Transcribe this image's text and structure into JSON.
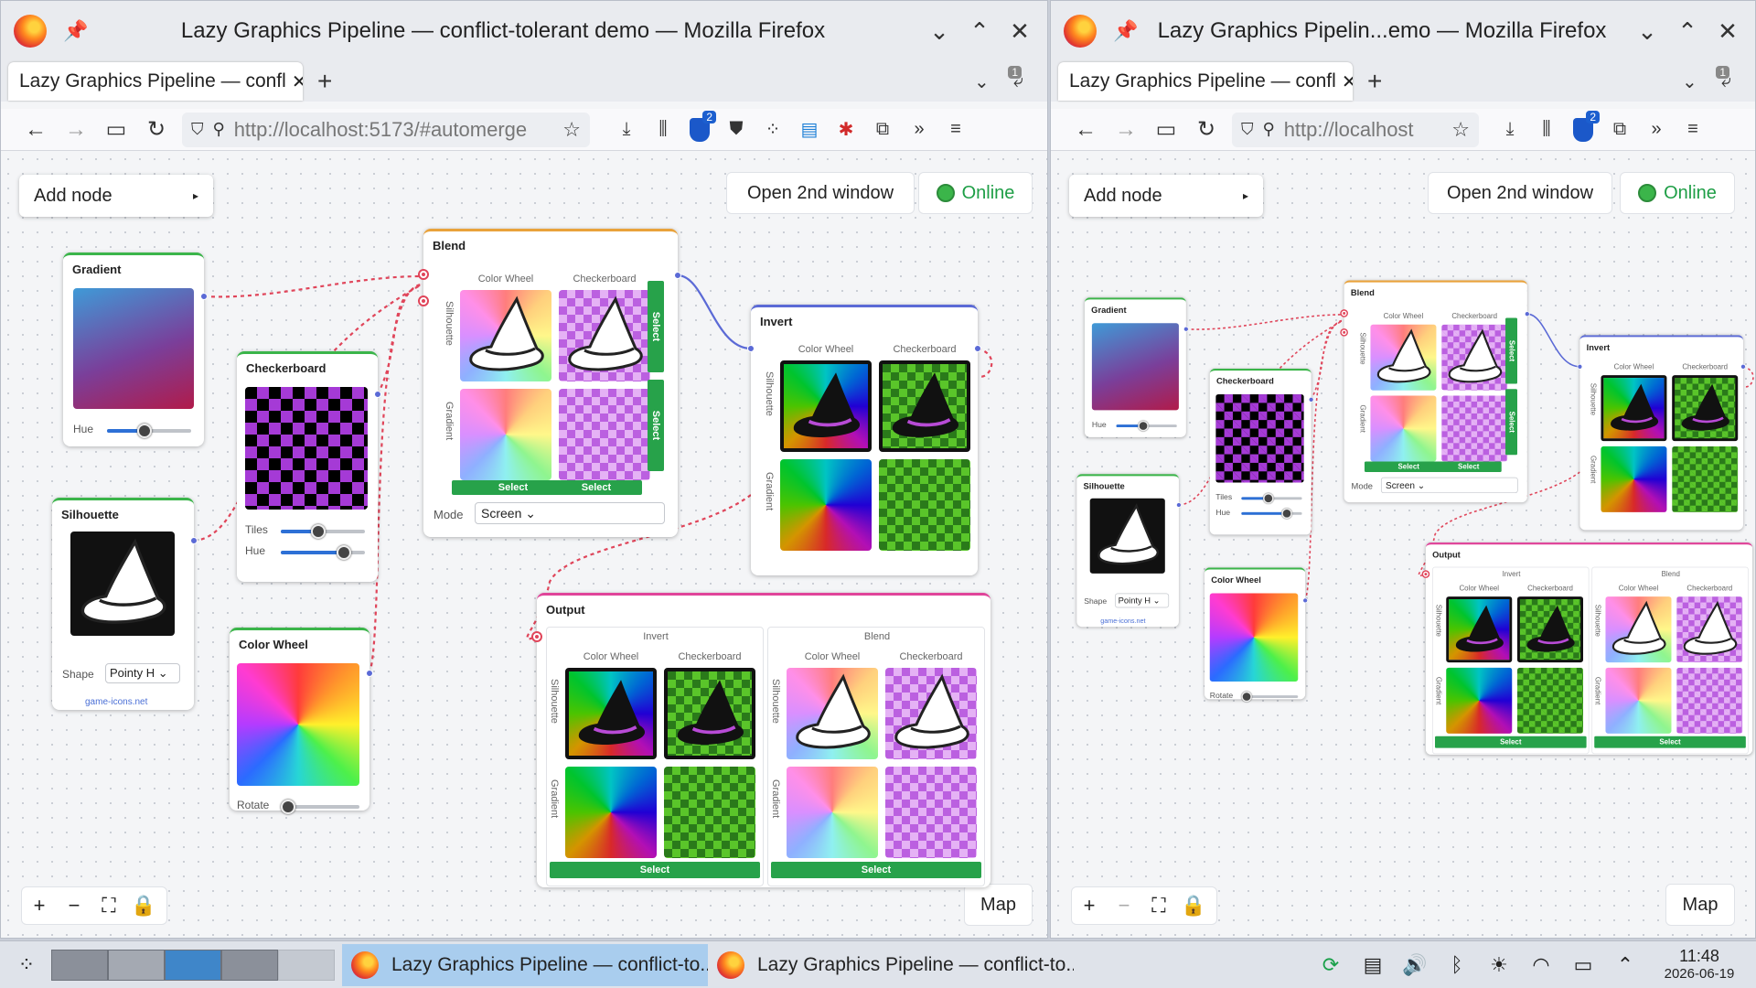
{
  "windows": [
    {
      "title": "Lazy Graphics Pipeline — conflict-tolerant demo — Mozilla Firefox",
      "tab": "Lazy Graphics Pipeline — confl",
      "url": "http://localhost:5173/#automerge",
      "tab_counter": "1",
      "ublock_count": "2"
    },
    {
      "title": "Lazy Graphics Pipelin...emo — Mozilla Firefox",
      "tab": "Lazy Graphics Pipeline — confl",
      "url": "http://localhost",
      "tab_counter": "1",
      "ublock_count": "2"
    }
  ],
  "app": {
    "add_node": "Add node",
    "open_second": "Open 2nd window",
    "online": "Online",
    "map": "Map",
    "nodes": {
      "gradient": {
        "title": "Gradient",
        "hue_label": "Hue",
        "hue": 0.45
      },
      "checkerboard": {
        "title": "Checkerboard",
        "tiles_label": "Tiles",
        "tiles": 0.45,
        "hue_label": "Hue",
        "hue": 0.75
      },
      "silhouette": {
        "title": "Silhouette",
        "shape_label": "Shape",
        "shape": "Pointy H",
        "credit": "game-icons.net"
      },
      "colorwheel": {
        "title": "Color Wheel",
        "rotate_label": "Rotate",
        "rotate": 0.05
      },
      "blend": {
        "title": "Blend",
        "col1": "Color Wheel",
        "col2": "Checkerboard",
        "row1": "Silhouette",
        "row2": "Gradient",
        "select": "Select",
        "mode_label": "Mode",
        "mode": "Screen"
      },
      "invert": {
        "title": "Invert",
        "col1": "Color Wheel",
        "col2": "Checkerboard",
        "row1": "Silhouette",
        "row2": "Gradient"
      },
      "output": {
        "title": "Output",
        "left": "Invert",
        "right": "Blend",
        "col1": "Color Wheel",
        "col2": "Checkerboard",
        "row1": "Silhouette",
        "row2": "Gradient",
        "select": "Select"
      }
    }
  },
  "taskbar": {
    "task1": "Lazy Graphics Pipeline — conflict-to...",
    "task2": "Lazy Graphics Pipeline — conflict-to...",
    "time": "11:48",
    "date": "2026-06-19"
  },
  "colors": {
    "accent": "#27a24a",
    "wire": "#e0455a",
    "link": "#5b6ad6"
  }
}
